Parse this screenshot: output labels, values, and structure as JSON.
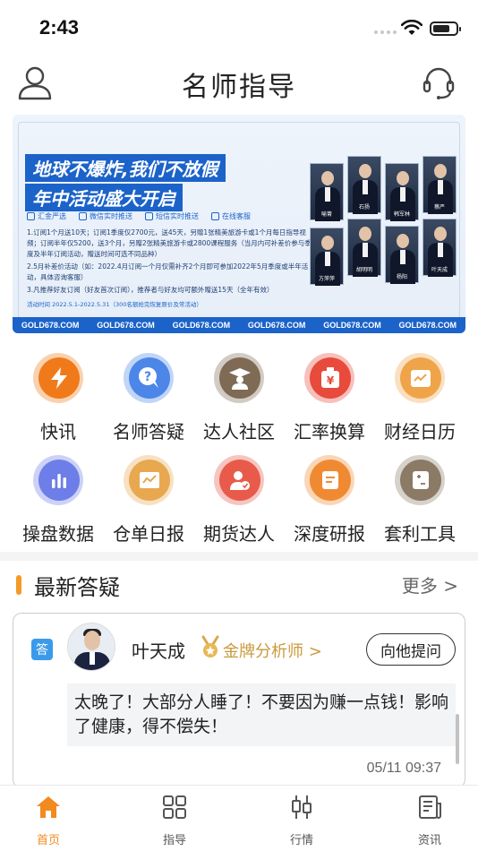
{
  "status_bar": {
    "time": "2:43"
  },
  "header": {
    "title": "名师指导"
  },
  "banner": {
    "headline_1": "地球不爆炸,我们不放假",
    "headline_2": "年中活动盛大开启",
    "features": [
      "汇金严选",
      "微信实时推送",
      "短信实时推送",
      "在线客服"
    ],
    "lines": [
      "1.订阅1个月送10天；订阅1季度仅2700元，送45天，另赠1张精美旅游卡或1个月每日指导视频；订阅半年仅5200，送3个月，另赠2张精美旅游卡或2800课程服务（当月内可补差价参与季度及半年订阅活动，赠送时间可选不同品种）",
      "2.5月补差价活动（如：2022.4月订阅一个月仅需补齐2个月即可参加2022年5月季度或半年活动，具体咨询客服）",
      "3.凡推荐好友订阅（好友首次订阅），推荐者与好友均可额外赠送15天（全年有效）"
    ],
    "dates": "活动时间 2022.5.1-2022.5.31（300名额抢完恢复原价及常活动）",
    "strip": [
      "GOLD678.COM",
      "GOLD678.COM",
      "GOLD678.COM",
      "GOLD678.COM",
      "GOLD678.COM",
      "GOLD678.COM"
    ],
    "analysts": [
      "喻箐",
      "石扬",
      "韩军林",
      "蔡严",
      "方萍萍",
      "胡明明",
      "杨阳",
      "叶天成"
    ]
  },
  "grid": [
    {
      "label": "快讯",
      "icon": "lightning-icon",
      "color": "#f07a1a"
    },
    {
      "label": "名师答疑",
      "icon": "question-chat-icon",
      "color": "#4c86e8"
    },
    {
      "label": "达人社区",
      "icon": "graduate-icon",
      "color": "#7f6a55"
    },
    {
      "label": "汇率换算",
      "icon": "yuan-bag-icon",
      "color": "#e84a3c"
    },
    {
      "label": "财经日历",
      "icon": "calendar-chart-icon",
      "color": "#f0a44a"
    },
    {
      "label": "操盘数据",
      "icon": "bar-chart-icon",
      "color": "#6d7ee8"
    },
    {
      "label": "仓单日报",
      "icon": "line-report-icon",
      "color": "#e8a850"
    },
    {
      "label": "期货达人",
      "icon": "user-check-icon",
      "color": "#e85a4a"
    },
    {
      "label": "深度研报",
      "icon": "document-icon",
      "color": "#f08a32"
    },
    {
      "label": "套利工具",
      "icon": "tool-icon",
      "color": "#8a7a66"
    }
  ],
  "section": {
    "title": "最新答疑",
    "more": "更多 >"
  },
  "card": {
    "badge": "答",
    "name": "叶天成",
    "title": "金牌分析师 >",
    "ask_label": "向他提问",
    "answer": "太晚了！大部分人睡了！不要因为赚一点钱！影响了健康，得不偿失！",
    "time": "05/11 09:37"
  },
  "tabs": [
    {
      "label": "首页",
      "icon": "home-icon",
      "active": true
    },
    {
      "label": "指导",
      "icon": "grid-icon",
      "active": false
    },
    {
      "label": "行情",
      "icon": "candlestick-icon",
      "active": false
    },
    {
      "label": "资讯",
      "icon": "news-icon",
      "active": false
    }
  ],
  "colors": {
    "accent": "#f28a1f",
    "brand_blue": "#1b63c9"
  }
}
